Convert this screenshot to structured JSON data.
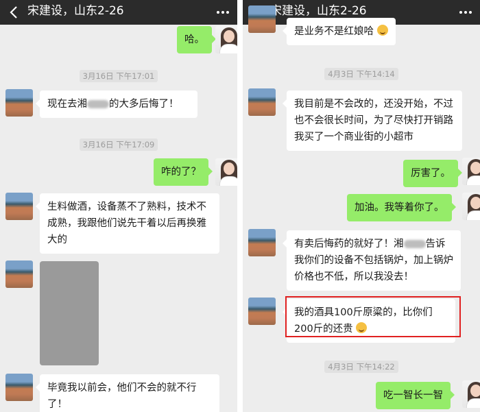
{
  "left": {
    "title": "宋建设，山东2-26",
    "messages": {
      "m1": "哈。",
      "t1": "3月16日 下午17:01",
      "m2a": "现在去湘",
      "m2b": "的大多后悔了！",
      "t2": "3月16日 下午17:09",
      "m3": "咋的了？",
      "m4": "生料做酒，设备蒸不了熟料，技术不成熟，我跟他们说先干着以后再换雅大的",
      "m6": "毕竟我以前会，他们不会的就不行了！"
    }
  },
  "right": {
    "title": "宋建设，山东2-26",
    "messages": {
      "m1": "是业务不是红娘哈",
      "t1": "4月3日 下午14:14",
      "m2": "我目前是不会改的，还没开始，不过也不会很长时间，为了尽快打开销路我买了一个商业街的小超市",
      "m3": "厉害了。",
      "m4": "加油。我等着你了。",
      "m5a": "有卖后悔药的就好了！湘",
      "m5b": "告诉我你们的设备不包括锅炉，加上锅炉价格也不低，所以我没去！",
      "m6": "我的酒具100斤原粱的，比你们200斤的还贵",
      "t2": "4月3日 下午14:22",
      "m7": "吃一智长一智"
    }
  },
  "colors": {
    "header": "#2b2b2b",
    "self_bubble": "#95ec69",
    "background": "#ededed",
    "highlight": "#e02020"
  },
  "icons": [
    "back-arrow-icon",
    "more-dots-icon",
    "smirk-emoji-icon",
    "cry-laugh-emoji-icon"
  ]
}
